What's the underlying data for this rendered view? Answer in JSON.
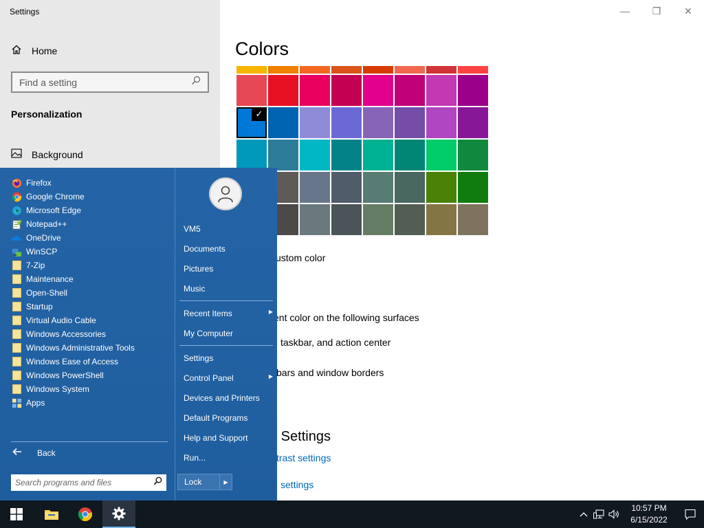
{
  "window": {
    "title": "Settings",
    "controls": {
      "minimize": "—",
      "restore": "❐",
      "close": "✕"
    }
  },
  "nav": {
    "home_label": "Home",
    "search_placeholder": "Find a setting",
    "section_label": "Personalization",
    "items": [
      {
        "label": "Background",
        "icon": "picture-icon"
      }
    ]
  },
  "main": {
    "heading": "Colors",
    "custom_color_label": "ustom color",
    "accent_surfaces_label": "ent color on the following surfaces",
    "taskbar_option_label": "taskbar, and action center",
    "titlebars_option_label": "bars and window borders",
    "related_heading": "d Settings",
    "contrast_link": "trast settings",
    "sync_link": "settings"
  },
  "colors": {
    "top_strip": [
      "#f7b500",
      "#f08000",
      "#f26722",
      "#d9541b",
      "#d83b01",
      "#ef6950",
      "#d13438",
      "#ff4343"
    ],
    "rows": [
      [
        "#e74856",
        "#e81123",
        "#ea005e",
        "#c30052",
        "#e3008c",
        "#bf0077",
        "#c239b3",
        "#9a0089"
      ],
      [
        "#0078d7",
        "#0063b1",
        "#8e8cd8",
        "#6b69d6",
        "#8764b8",
        "#744da9",
        "#b146c2",
        "#881798"
      ],
      [
        "#0099bc",
        "#2d7d9a",
        "#00b7c3",
        "#038387",
        "#00b294",
        "#018574",
        "#00cc6a",
        "#10893e"
      ],
      [
        "#7a7574",
        "#5d5a58",
        "#68768a",
        "#515c6b",
        "#567c73",
        "#486860",
        "#498205",
        "#107c10"
      ],
      [
        "#767676",
        "#4c4a48",
        "#69797e",
        "#4a5459",
        "#647c64",
        "#525e54",
        "#847545",
        "#7e735f"
      ]
    ],
    "selected": {
      "row": 1,
      "col": 0,
      "check": "✓"
    }
  },
  "start_menu": {
    "programs": [
      {
        "label": "Firefox",
        "icon": "firefox-icon"
      },
      {
        "label": "Google Chrome",
        "icon": "chrome-icon"
      },
      {
        "label": "Microsoft Edge",
        "icon": "edge-icon"
      },
      {
        "label": "Notepad++",
        "icon": "notepadpp-icon"
      },
      {
        "label": "OneDrive",
        "icon": "onedrive-icon"
      },
      {
        "label": "WinSCP",
        "icon": "winscp-icon"
      },
      {
        "label": "7-Zip",
        "icon": "folder-icon"
      },
      {
        "label": "Maintenance",
        "icon": "folder-icon"
      },
      {
        "label": "Open-Shell",
        "icon": "folder-icon"
      },
      {
        "label": "Startup",
        "icon": "folder-icon"
      },
      {
        "label": "Virtual Audio Cable",
        "icon": "folder-icon"
      },
      {
        "label": "Windows Accessories",
        "icon": "folder-icon"
      },
      {
        "label": "Windows Administrative Tools",
        "icon": "folder-icon"
      },
      {
        "label": "Windows Ease of Access",
        "icon": "folder-icon"
      },
      {
        "label": "Windows PowerShell",
        "icon": "folder-icon"
      },
      {
        "label": "Windows System",
        "icon": "folder-icon"
      },
      {
        "label": "Apps",
        "icon": "apps-icon"
      }
    ],
    "back_label": "Back",
    "search_placeholder": "Search programs and files",
    "right": {
      "user": "VM5",
      "documents": "Documents",
      "pictures": "Pictures",
      "music": "Music",
      "recent_items": "Recent Items",
      "my_computer": "My Computer",
      "settings": "Settings",
      "control_panel": "Control Panel",
      "devices_printers": "Devices and Printers",
      "default_programs": "Default Programs",
      "help_support": "Help and Support",
      "run": "Run...",
      "lock": "Lock"
    }
  },
  "taskbar": {
    "pinned": [
      "windows-start-icon",
      "file-explorer-icon",
      "chrome-icon",
      "settings-gear-icon"
    ],
    "clock_time": "10:57 PM",
    "clock_date": "6/15/2022"
  }
}
